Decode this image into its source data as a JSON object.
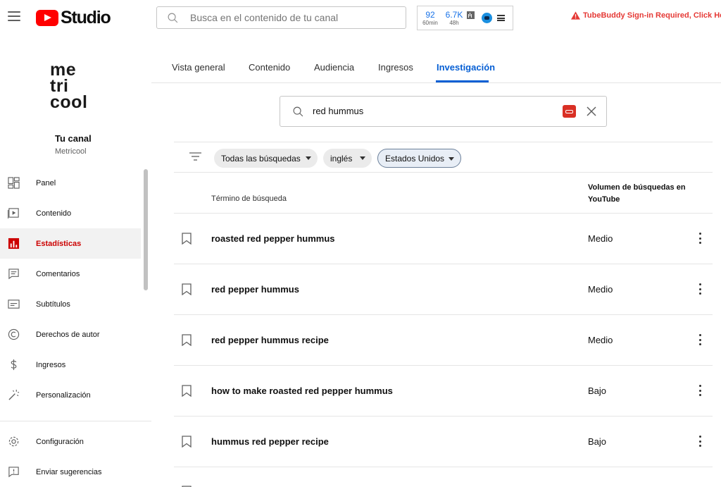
{
  "header": {
    "logo_text": "Studio",
    "search_placeholder": "Busca en el contenido de tu canal",
    "tubebuddy": {
      "stat1_value": "92",
      "stat1_sub": "60min",
      "stat2_value": "6.7K",
      "stat2_sub": "48h",
      "warning": "TubeBuddy Sign-in Required, Click Here"
    }
  },
  "sidebar": {
    "logo_lines": [
      "me",
      "tri",
      "cool"
    ],
    "channel_label": "Tu canal",
    "channel_name": "Metricool",
    "items": [
      {
        "label": "Panel",
        "icon": "dashboard-icon"
      },
      {
        "label": "Contenido",
        "icon": "video-icon"
      },
      {
        "label": "Estadísticas",
        "icon": "analytics-icon",
        "active": true
      },
      {
        "label": "Comentarios",
        "icon": "comments-icon"
      },
      {
        "label": "Subtítulos",
        "icon": "subtitles-icon"
      },
      {
        "label": "Derechos de autor",
        "icon": "copyright-icon"
      },
      {
        "label": "Ingresos",
        "icon": "dollar-icon"
      },
      {
        "label": "Personalización",
        "icon": "magic-wand-icon"
      }
    ],
    "bottom_items": [
      {
        "label": "Configuración",
        "icon": "gear-icon"
      },
      {
        "label": "Enviar sugerencias",
        "icon": "feedback-icon"
      }
    ]
  },
  "tabs": [
    {
      "label": "Vista general"
    },
    {
      "label": "Contenido"
    },
    {
      "label": "Audiencia"
    },
    {
      "label": "Ingresos"
    },
    {
      "label": "Investigación",
      "active": true
    }
  ],
  "research": {
    "query": "red hummus",
    "filters": [
      {
        "label": "Todas las búsquedas"
      },
      {
        "label": "inglés"
      },
      {
        "label": "Estados Unidos",
        "selected": true
      }
    ],
    "columns": {
      "term": "Término de búsqueda",
      "volume_line1": "Volumen de búsquedas en",
      "volume_line2": "YouTube"
    },
    "rows": [
      {
        "term": "roasted red pepper hummus",
        "volume": "Medio"
      },
      {
        "term": "red pepper hummus",
        "volume": "Medio"
      },
      {
        "term": "red pepper hummus recipe",
        "volume": "Medio"
      },
      {
        "term": "how to make roasted red pepper hummus",
        "volume": "Bajo"
      },
      {
        "term": "hummus red pepper recipe",
        "volume": "Bajo"
      }
    ]
  },
  "colors": {
    "accent": "#065fd4",
    "brand_red": "#ff0000",
    "active_nav": "#cc0000",
    "warning": "#e53935"
  }
}
